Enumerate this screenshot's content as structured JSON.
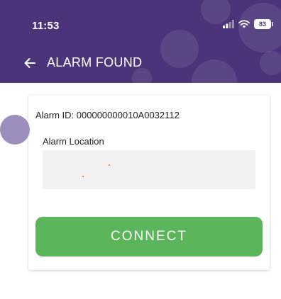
{
  "status_bar": {
    "time": "11:53",
    "battery": "83",
    "signal_icon": "cellular-signal-icon",
    "wifi_icon": "wifi-icon"
  },
  "app_bar": {
    "title": "ALARM FOUND",
    "back_icon": "arrow-left-icon"
  },
  "card": {
    "alarm_id": "Alarm ID: 000000000010A0032112",
    "location_label": "Alarm Location",
    "connect_label": "CONNECT"
  },
  "colors": {
    "header_bg": "#4b3479",
    "button_green": "#5bb55a",
    "floating_circle": "#9c8fbd",
    "location_dot": "#e3772c"
  }
}
